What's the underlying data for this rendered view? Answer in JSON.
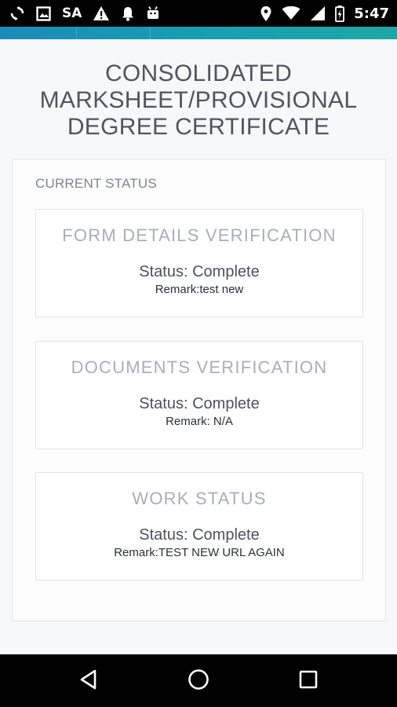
{
  "status_bar": {
    "carrier_text": "SA",
    "time": "5:47",
    "left_icons": [
      "sync-icon",
      "image-icon",
      "warning-icon",
      "bell-icon",
      "android-icon"
    ],
    "right_icons": [
      "location-icon",
      "wifi-icon",
      "signal-icon",
      "battery-icon"
    ]
  },
  "colors": {
    "accent_start": "#1b8ab8",
    "accent_end": "#1aa8a3",
    "background": "#f7f8f9"
  },
  "page": {
    "title_line1": "CONSOLIDATED",
    "title_line2": "MARKSHEET/PROVISIONAL",
    "title_line3": "DEGREE CERTIFICATE"
  },
  "current_status": {
    "heading": "CURRENT STATUS",
    "steps": [
      {
        "title": "FORM DETAILS VERIFICATION",
        "status": "Status: Complete",
        "remark": "Remark:test new"
      },
      {
        "title": "DOCUMENTS VERIFICATION",
        "status": "Status: Complete",
        "remark": "Remark: N/A"
      },
      {
        "title": "WORK STATUS",
        "status": "Status: Complete",
        "remark": "Remark:TEST NEW URL AGAIN"
      }
    ]
  },
  "nav_bar": {
    "buttons": [
      "back-icon",
      "home-icon",
      "recents-icon"
    ]
  }
}
